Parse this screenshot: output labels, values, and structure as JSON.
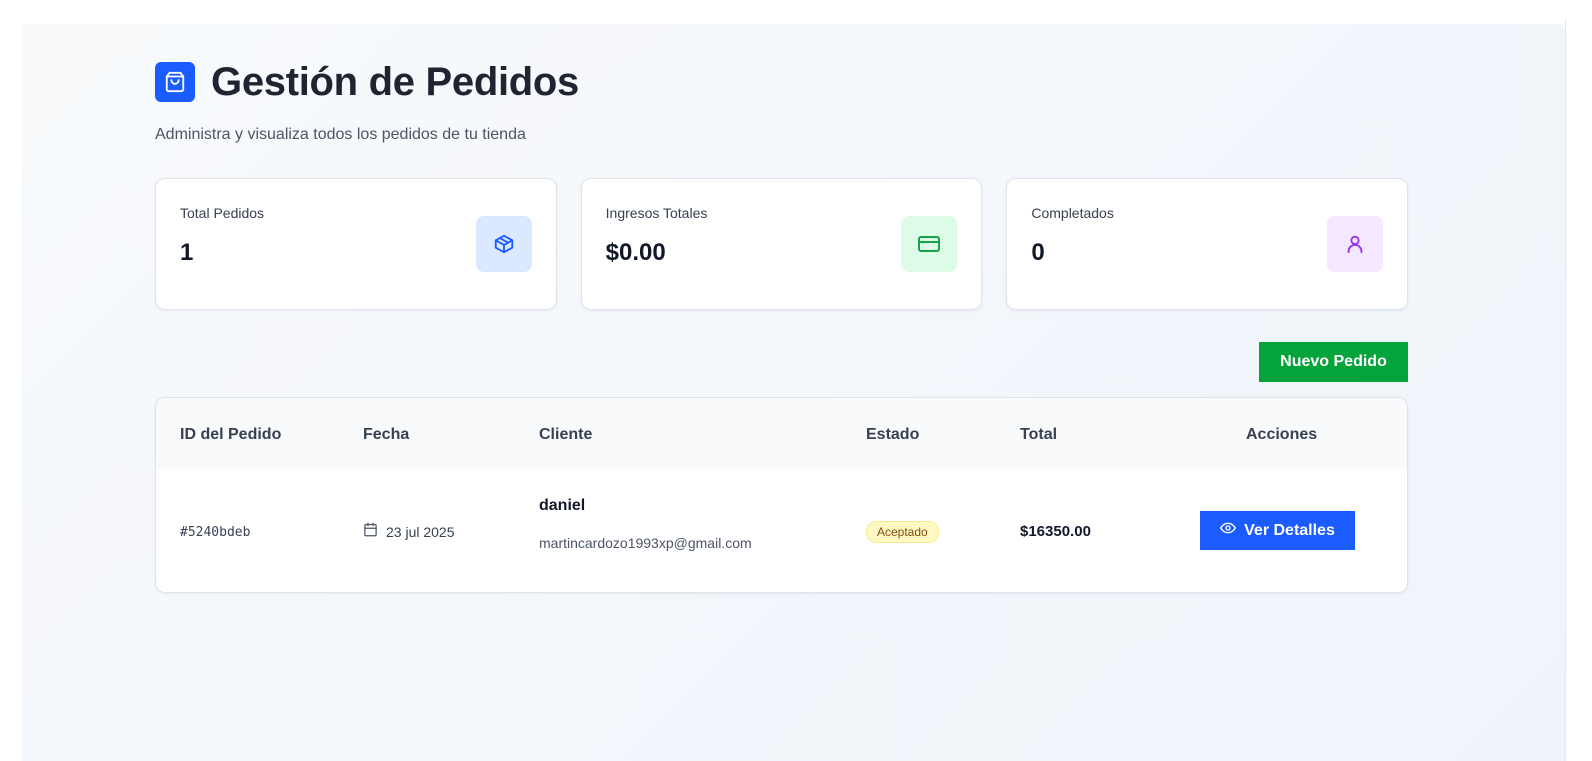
{
  "header": {
    "title": "Gestión de Pedidos",
    "subtitle": "Administra y visualiza todos los pedidos de tu tienda",
    "logo_icon": "shopping-bag-icon"
  },
  "stats": [
    {
      "label": "Total Pedidos",
      "value": "1",
      "icon": "package-icon",
      "color": "#1a5cff"
    },
    {
      "label": "Ingresos Totales",
      "value": "$0.00",
      "icon": "credit-card-icon",
      "color": "#16a34a"
    },
    {
      "label": "Completados",
      "value": "0",
      "icon": "user-icon",
      "color": "#9333ea"
    }
  ],
  "actions": {
    "new_order_label": "Nuevo Pedido"
  },
  "table": {
    "columns": [
      "ID del Pedido",
      "Fecha",
      "Cliente",
      "Estado",
      "Total",
      "Acciones"
    ],
    "rows": [
      {
        "id": "#5240bdeb",
        "date": "23 jul 2025",
        "client_name": "daniel",
        "client_email": "martincardozo1993xp@gmail.com",
        "status": "Aceptado",
        "total": "$16350.00",
        "action_label": "Ver Detalles"
      }
    ]
  },
  "colors": {
    "primary": "#1a5cff",
    "success": "#05a33c",
    "status_accepted_bg": "#fef9c3"
  }
}
